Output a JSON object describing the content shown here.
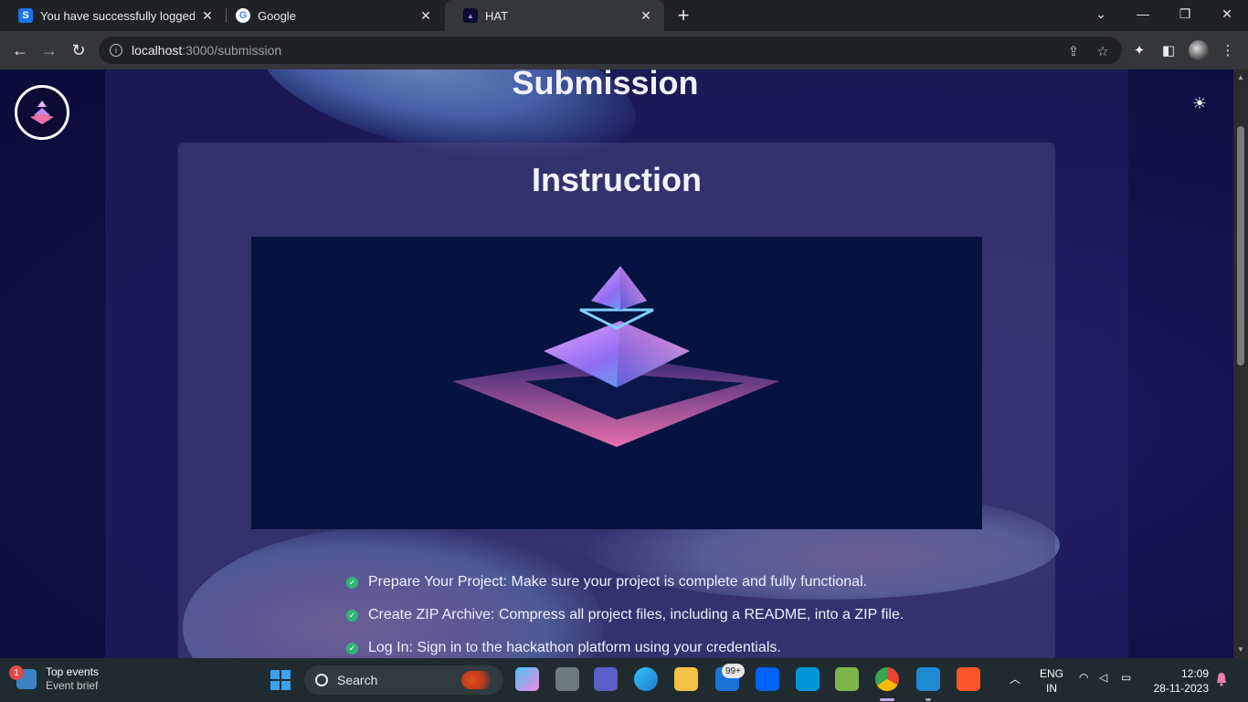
{
  "browser": {
    "tabs": [
      {
        "label": "You have successfully logged on",
        "favicon": "S"
      },
      {
        "label": "Google",
        "favicon": "G"
      },
      {
        "label": "HAT",
        "favicon": ""
      }
    ],
    "url_host": "localhost",
    "url_path": ":3000/submission"
  },
  "page": {
    "title": "Submission",
    "card_title": "Instruction",
    "steps": [
      "Prepare Your Project: Make sure your project is complete and fully functional.",
      "Create ZIP Archive: Compress all project files, including a README, into a ZIP file.",
      "Log In: Sign in to the hackathon platform using your credentials."
    ]
  },
  "taskbar": {
    "weather_badge": "1",
    "weather_title": "Top events",
    "weather_sub": "Event brief",
    "search_label": "Search",
    "mail_badge": "99+",
    "lang_line1": "ENG",
    "lang_line2": "IN",
    "time": "12:09",
    "date": "28-11-2023"
  }
}
